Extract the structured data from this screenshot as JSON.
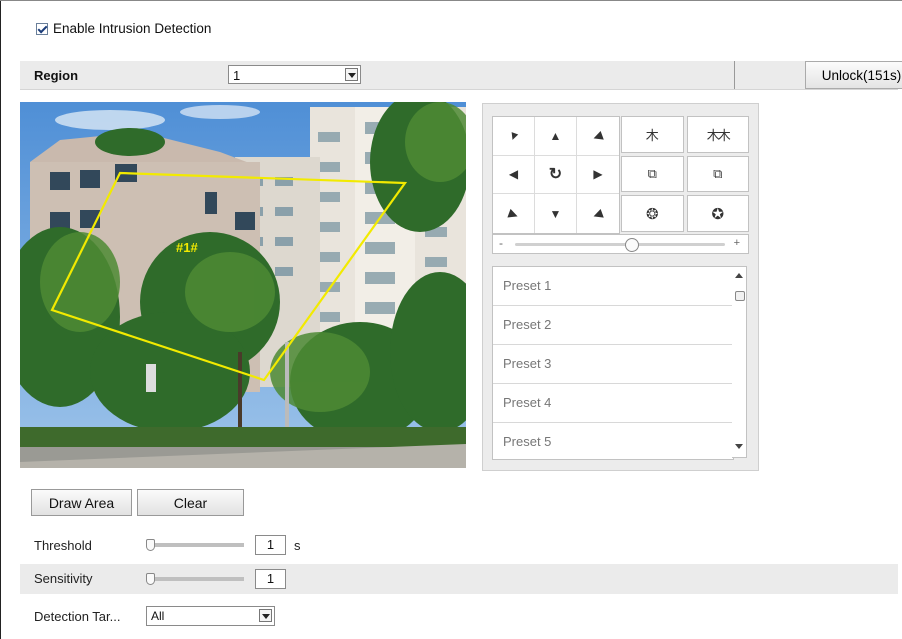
{
  "intrusion": {
    "enable_label": "Enable Intrusion Detection",
    "enabled": true
  },
  "region": {
    "label": "Region",
    "selected": "1",
    "unlock_label": "Unlock(151s)"
  },
  "video": {
    "area_label": "#1#"
  },
  "ptz": {
    "directions": [
      "▼",
      "▲",
      "◀",
      "◀",
      "↻",
      "▶",
      "▶",
      "▼",
      "◀"
    ],
    "lens_buttons": [
      "zoom-in",
      "zoom-out",
      "focus-near",
      "focus-far",
      "iris-open",
      "iris-close"
    ],
    "speed_minus": "-",
    "speed_plus": "+",
    "speed_level": 0.55,
    "presets": [
      "Preset 1",
      "Preset 2",
      "Preset 3",
      "Preset 4",
      "Preset 5"
    ]
  },
  "actions": {
    "draw_area": "Draw Area",
    "clear": "Clear"
  },
  "settings": {
    "threshold_label": "Threshold",
    "threshold_value": "1",
    "threshold_unit": "s",
    "sensitivity_label": "Sensitivity",
    "sensitivity_value": "1",
    "detection_target_label": "Detection Tar...",
    "detection_target_value": "All"
  },
  "colors": {
    "area_outline": "#f2ea00",
    "band_gray": "#ebebeb"
  }
}
